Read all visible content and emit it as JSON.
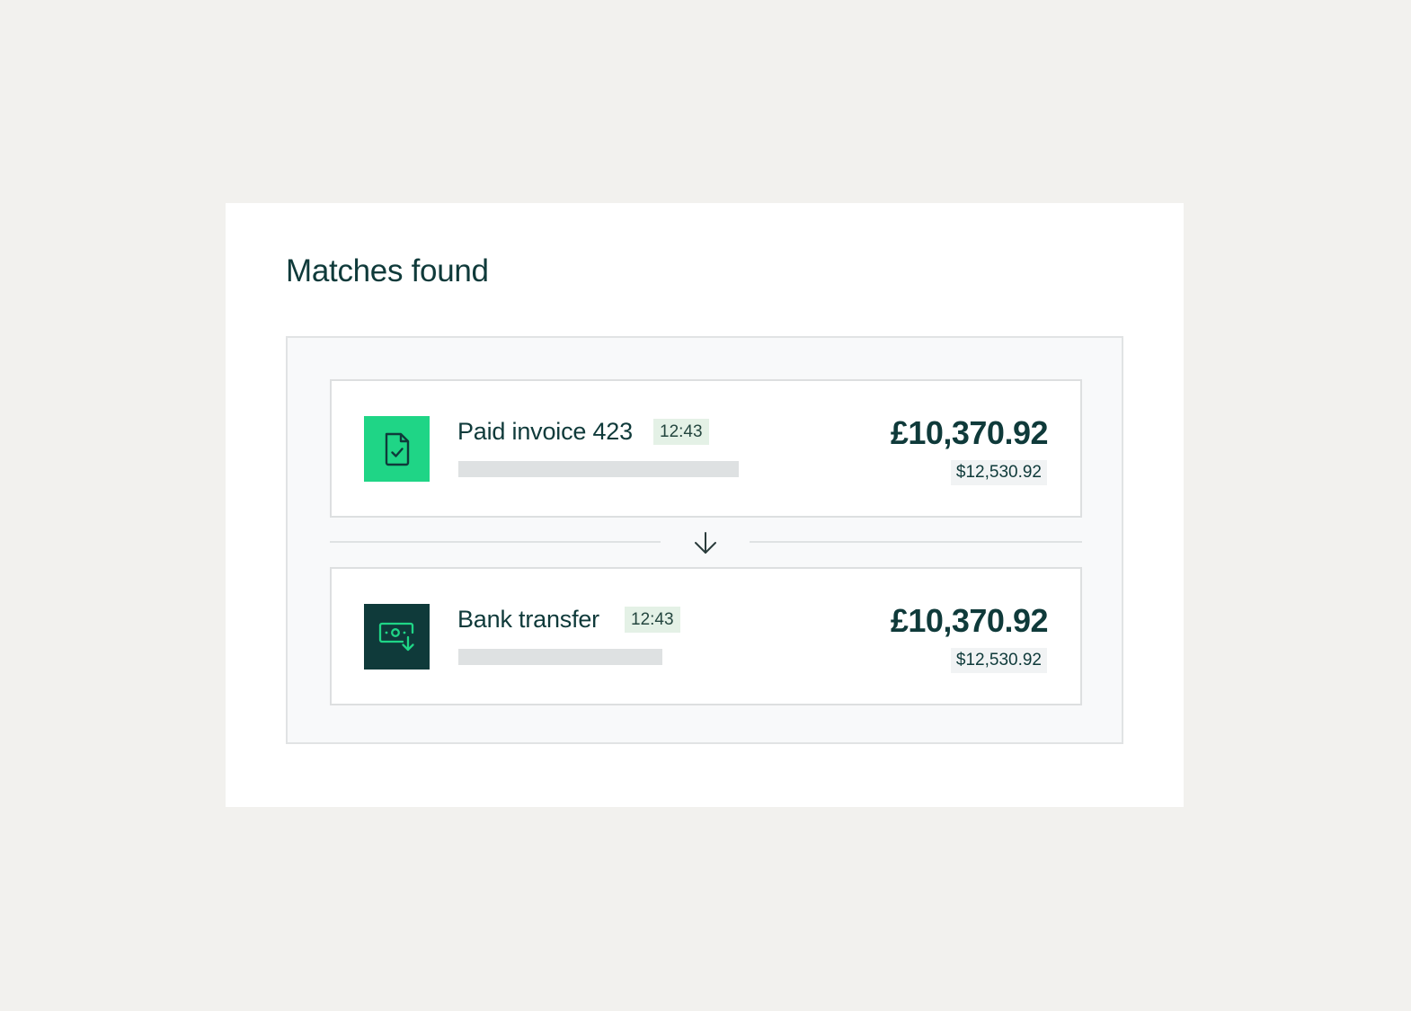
{
  "title": "Matches found",
  "matches": [
    {
      "icon": "document-check-icon",
      "label": "Paid invoice 423",
      "time": "12:43",
      "amount": "£10,370.92",
      "sub_amount": "$12,530.92"
    },
    {
      "icon": "banknote-download-icon",
      "label": "Bank transfer",
      "time": "12:43",
      "amount": "£10,370.92",
      "sub_amount": "$12,530.92"
    }
  ],
  "connector_icon": "arrow-down-icon",
  "colors": {
    "background": "#f2f1ee",
    "invoice_tile": "#1fd586",
    "bank_tile": "#0f3a3a",
    "accent_green": "#1fd586",
    "text_dark": "#0f3a3a",
    "time_badge_bg": "#e4f1e6"
  }
}
